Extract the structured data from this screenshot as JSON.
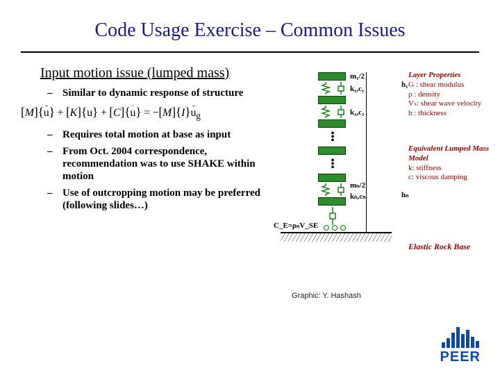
{
  "title": "Code Usage Exercise – Common Issues",
  "subhead": "Input motion issue (lumped mass)",
  "bullets": {
    "b1": "Similar to dynamic response of structure",
    "b2": "Requires total motion at base as input",
    "b3": "From Oct. 2004 correspondence, recommendation was to use SHAKE within motion",
    "b4": "Use of outcropping motion may be preferred (following slides…)"
  },
  "equation": {
    "M": "M",
    "K": "K",
    "C": "C",
    "u": "u",
    "ug": "u",
    "I": "I",
    "g": "g",
    "lbr": "[",
    "rbr": "]",
    "lcb": "{",
    "rcb": "}",
    "plus": "+",
    "eq": "=",
    "minus": "−"
  },
  "diagram": {
    "m1": "m₁/2",
    "k1": "k₁,c₁",
    "h1": "h₁",
    "m2": "",
    "k2": "k₂,c₂",
    "mn": "mₙ/2",
    "kn": "kₙ,cₙ",
    "hn": "hₙ",
    "ce": "C_E=ρₙV_SE",
    "layer_props_hdr": "Layer Properties",
    "lp1": "G : shear modulus",
    "lp2": "ρ : density",
    "lp3": "Vₛ: shear wave velocity",
    "lp4": "h : thickness",
    "lumped_hdr": "Equivalent Lumped Mass Model",
    "lm1": "k: stiffness",
    "lm2": "c: viscous damping",
    "erb": "Elastic Rock Base"
  },
  "credit": "Graphic: Y. Hashash",
  "logo": "PEER"
}
